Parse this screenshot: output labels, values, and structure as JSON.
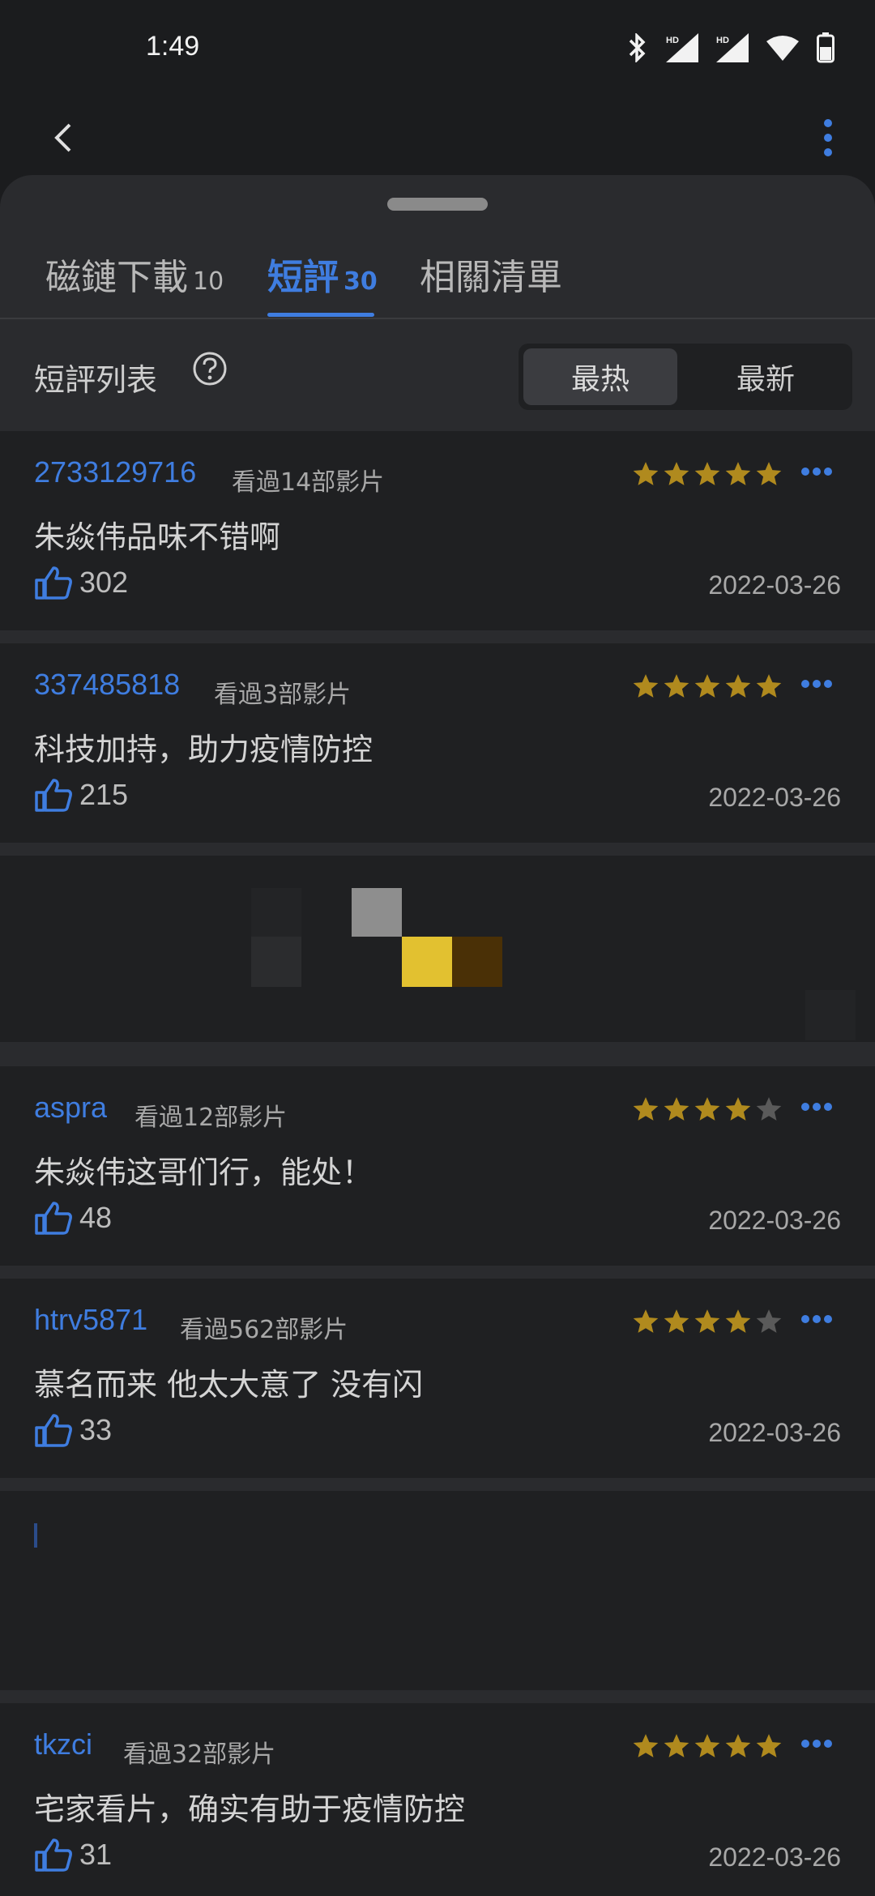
{
  "status": {
    "time": "1:49"
  },
  "tabs": [
    {
      "label": "磁鏈下載",
      "count": "10"
    },
    {
      "label": "短評",
      "count": "30"
    },
    {
      "label": "相關清單",
      "count": ""
    }
  ],
  "list_header": {
    "title": "短評列表",
    "sort_hot": "最热",
    "sort_new": "最新"
  },
  "reviews": [
    {
      "user": "2733129716",
      "watched": "看過14部影片",
      "rating": 5,
      "comment": "朱焱伟品味不错啊",
      "likes": "302",
      "date": "2022-03-26"
    },
    {
      "user": "337485818",
      "watched": "看過3部影片",
      "rating": 5,
      "comment": "科技加持，助力疫情防控",
      "likes": "215",
      "date": "2022-03-26"
    },
    {
      "user": "aspra",
      "watched": "看過12部影片",
      "rating": 4,
      "comment": "朱焱伟这哥们行，能处！",
      "likes": "48",
      "date": "2022-03-26"
    },
    {
      "user": "htrv5871",
      "watched": "看過562部影片",
      "rating": 4,
      "comment": "慕名而来 他太大意了 没有闪",
      "likes": "33",
      "date": "2022-03-26"
    },
    {
      "user": "tkzci",
      "watched": "看過32部影片",
      "rating": 5,
      "comment": "宅家看片，确实有助于疫情防控",
      "likes": "31",
      "date": "2022-03-26"
    }
  ],
  "colors": {
    "accent": "#3f7de0",
    "star_on": "#b08a1e",
    "star_off": "#5a5a5a"
  }
}
